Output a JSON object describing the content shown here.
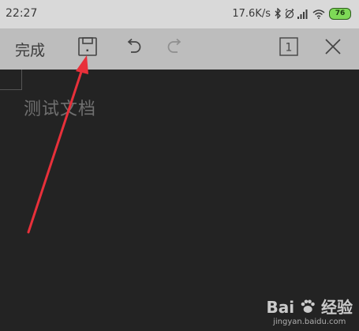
{
  "status_bar": {
    "time": "22:27",
    "network_speed": "17.6K/s",
    "battery_level": "76",
    "icons": [
      "bluetooth-icon",
      "alarm-off-icon",
      "signal-icon",
      "wifi-icon",
      "battery-icon"
    ]
  },
  "toolbar": {
    "done_label": "完成",
    "icons": [
      "save-icon",
      "undo-icon",
      "redo-icon",
      "page-count-icon",
      "close-icon"
    ],
    "page_count": "1"
  },
  "document": {
    "text": "测试文档"
  },
  "watermark": {
    "brand_latin": "Bai",
    "brand_cn": "经验",
    "url": "jingyan.baidu.com"
  },
  "colors": {
    "status_bar_bg": "#d9d9d9",
    "toolbar_bg": "#bdbdbd",
    "document_bg": "#232323",
    "arrow": "#e8303a",
    "battery": "#7ed957"
  }
}
